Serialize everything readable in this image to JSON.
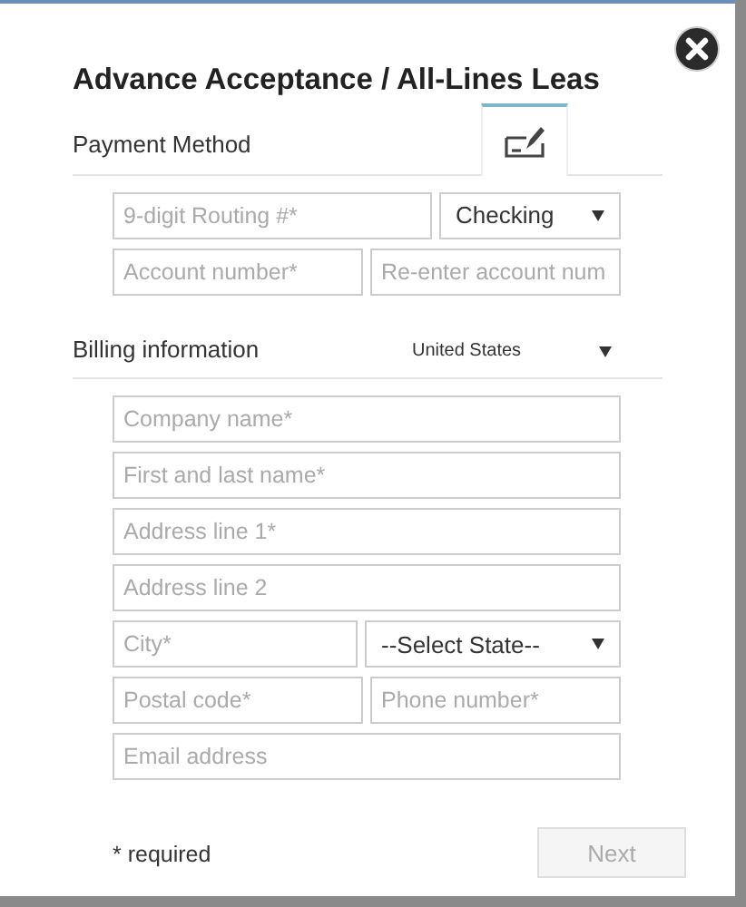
{
  "dialog": {
    "title": "Advance Acceptance / All-Lines Leas"
  },
  "payment": {
    "label": "Payment Method",
    "tabs": [
      {
        "selected": true
      }
    ],
    "rows": [
      [
        {
          "kind": "input",
          "placeholder": "9-digit Routing #*"
        },
        {
          "kind": "select",
          "value": "Checking"
        }
      ],
      [
        {
          "kind": "input",
          "placeholder": "Account number*"
        },
        {
          "kind": "input",
          "placeholder": "Re-enter account num"
        }
      ]
    ]
  },
  "billing": {
    "label": "Billing information",
    "country": "United States",
    "rows": [
      [
        {
          "kind": "input",
          "placeholder": "Company name*"
        }
      ],
      [
        {
          "kind": "input",
          "placeholder": "First and last name*"
        }
      ],
      [
        {
          "kind": "input",
          "placeholder": "Address line 1*"
        }
      ],
      [
        {
          "kind": "input",
          "placeholder": "Address line 2"
        }
      ],
      [
        {
          "kind": "input",
          "placeholder": "City*"
        },
        {
          "kind": "select",
          "value": "--Select State--"
        }
      ],
      [
        {
          "kind": "input",
          "placeholder": "Postal code*"
        },
        {
          "kind": "input",
          "placeholder": "Phone number*"
        }
      ],
      [
        {
          "kind": "input",
          "placeholder": "Email address"
        }
      ]
    ]
  },
  "footer": {
    "note": "* required",
    "next": {
      "label": "Next",
      "disabled": true
    }
  }
}
